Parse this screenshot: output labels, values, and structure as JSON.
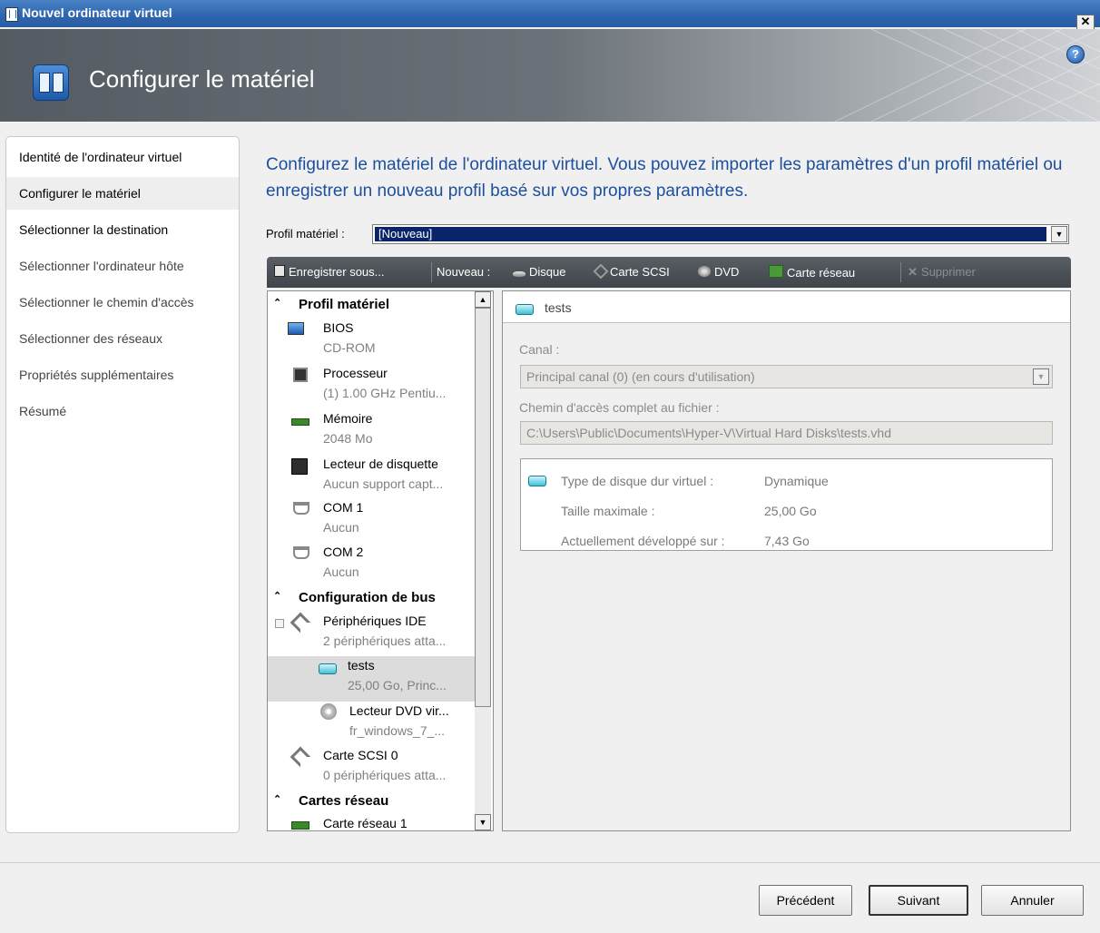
{
  "window": {
    "title": "Nouvel ordinateur virtuel",
    "close": "✕"
  },
  "header": {
    "title": "Configurer le matériel",
    "help": "?"
  },
  "nav": {
    "items": [
      {
        "label": "Identité de l'ordinateur virtuel"
      },
      {
        "label": "Configurer le matériel"
      },
      {
        "label": "Sélectionner la destination"
      },
      {
        "label": "Sélectionner l'ordinateur hôte"
      },
      {
        "label": "Sélectionner le chemin d'accès"
      },
      {
        "label": "Sélectionner des réseaux"
      },
      {
        "label": "Propriétés supplémentaires"
      },
      {
        "label": "Résumé"
      }
    ],
    "active_index": 1
  },
  "intro": "Configurez le matériel de l'ordinateur virtuel. Vous pouvez importer les paramètres d'un profil matériel ou enregistrer un nouveau profil basé sur vos propres paramètres.",
  "profile": {
    "label": "Profil matériel :",
    "value": "[Nouveau]"
  },
  "toolbar": {
    "save_as": "Enregistrer sous...",
    "new": "Nouveau :",
    "disk": "Disque",
    "scsi": "Carte SCSI",
    "dvd": "DVD",
    "network": "Carte réseau",
    "delete": "Supprimer"
  },
  "tree": {
    "sec_profile": "Profil matériel",
    "bios": {
      "title": "BIOS",
      "sub": "CD-ROM"
    },
    "cpu": {
      "title": "Processeur",
      "sub": "(1) 1.00 GHz Pentiu..."
    },
    "mem": {
      "title": "Mémoire",
      "sub": "2048 Mo"
    },
    "floppy": {
      "title": "Lecteur de disquette",
      "sub": "Aucun support capt..."
    },
    "com1": {
      "title": "COM 1",
      "sub": "Aucun"
    },
    "com2": {
      "title": "COM 2",
      "sub": "Aucun"
    },
    "sec_bus": "Configuration de bus",
    "ide": {
      "title": "Périphériques IDE",
      "sub": "2 périphériques atta..."
    },
    "tests": {
      "title": "tests",
      "sub": "25,00 Go, Princ..."
    },
    "dvd": {
      "title": "Lecteur DVD vir...",
      "sub": "fr_windows_7_..."
    },
    "scsi": {
      "title": "Carte SCSI 0",
      "sub": "0 périphériques atta..."
    },
    "sec_net": "Cartes réseau",
    "net1": {
      "title": "Carte réseau 1"
    }
  },
  "detail": {
    "title": "tests",
    "channel_label": "Canal :",
    "channel_value": "Principal canal (0) (en cours d'utilisation)",
    "path_label": "Chemin d'accès complet au fichier :",
    "path_value": "C:\\Users\\Public\\Documents\\Hyper-V\\Virtual Hard Disks\\tests.vhd",
    "props": [
      {
        "label": "Type de disque dur virtuel :",
        "value": "Dynamique"
      },
      {
        "label": "Taille maximale :",
        "value": "25,00 Go"
      },
      {
        "label": "Actuellement développé sur :",
        "value": "7,43 Go"
      }
    ]
  },
  "footer": {
    "prev": "Précédent",
    "next": "Suivant",
    "cancel": "Annuler"
  }
}
